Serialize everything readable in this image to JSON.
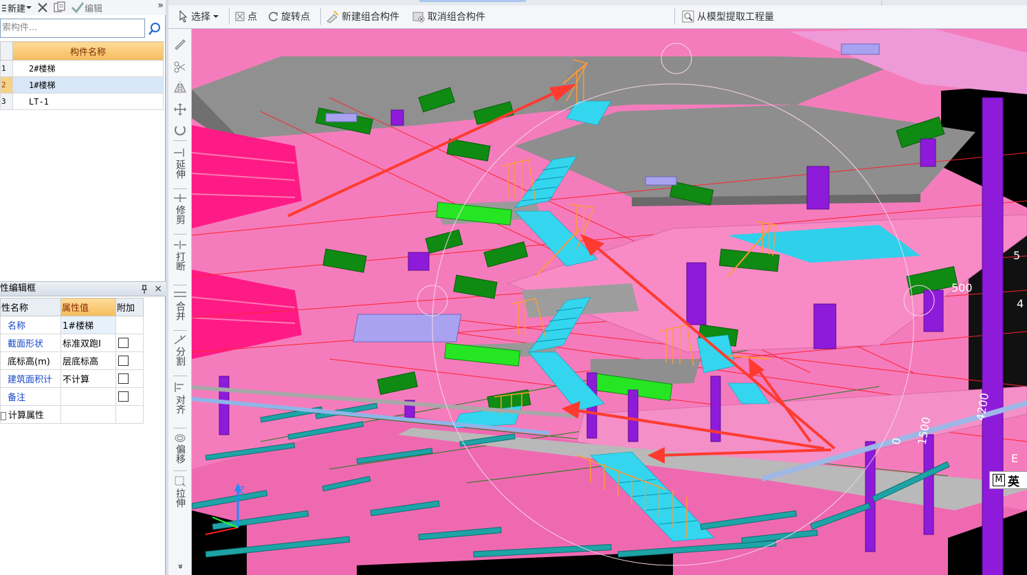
{
  "left_toolbar": {
    "new_label": "新建",
    "edit_label": "编辑",
    "more_label": "»"
  },
  "search": {
    "placeholder": "搜索构件...",
    "value": "索构件..."
  },
  "component_list": {
    "header": "构件名称",
    "rows": [
      {
        "idx": "1",
        "name": "2#楼梯"
      },
      {
        "idx": "2",
        "name": "1#楼梯"
      },
      {
        "idx": "3",
        "name": "LT-1"
      }
    ],
    "selected_index": 1
  },
  "property_panel": {
    "title": "性编辑框",
    "pin": "ᵖ",
    "close": "×",
    "headers": {
      "name": "性名称",
      "value": "属性值",
      "extra": "附加"
    },
    "rows": [
      {
        "name": "名称",
        "value": "1#楼梯",
        "has_checkbox": false
      },
      {
        "name": "截面形状",
        "value": "标准双跑I",
        "has_checkbox": true
      },
      {
        "name": "底标高(m)",
        "value": "层底标高",
        "has_checkbox": true
      },
      {
        "name": "建筑面积计",
        "value": "不计算",
        "has_checkbox": true
      },
      {
        "name": "备注",
        "value": "",
        "has_checkbox": true
      }
    ],
    "group_row": "计算属性"
  },
  "main_toolbar": {
    "select": "选择",
    "point": "点",
    "rotate_point": "旋转点",
    "new_group": "新建组合构件",
    "cancel_group": "取消组合构件",
    "extract_quantity": "从模型提取工程量"
  },
  "vertical_toolbar": {
    "extend": "延伸",
    "trim": "修剪",
    "break": "打断",
    "merge": "合并",
    "split": "分割",
    "align": "对齐",
    "offset": "偏移",
    "stretch": "拉伸",
    "more": "»"
  },
  "viewport": {
    "badge_letter": "M",
    "badge_text": "英",
    "dim_labels": [
      "5",
      "500",
      "4",
      "0",
      "1500",
      "4200",
      "E"
    ],
    "axis_z": "Z",
    "colors": {
      "slab_pink": "#f57cbc",
      "slab_grey": "#8f8f8f",
      "beam_green": "#0f8a12",
      "column_purple": "#8e1bd9",
      "stair_cyan": "#33d6ee",
      "railing_orange": "#ff9a35",
      "arrow_red": "#ff3b30"
    }
  }
}
